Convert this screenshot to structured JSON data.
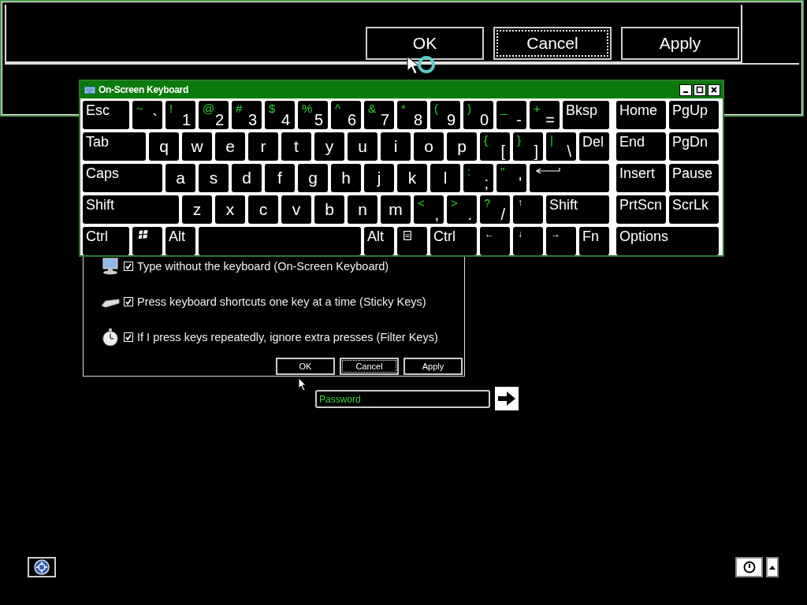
{
  "background_window": {
    "buttons": [
      {
        "label": "OK",
        "focused": false
      },
      {
        "label": "Cancel",
        "focused": true
      },
      {
        "label": "Apply",
        "focused": false
      }
    ]
  },
  "on_screen_keyboard": {
    "title": "On-Screen Keyboard",
    "rows": [
      {
        "keys": [
          {
            "kind": "label",
            "label": "Esc"
          },
          {
            "kind": "dual",
            "shift": "~",
            "base": "`"
          },
          {
            "kind": "dual",
            "shift": "!",
            "base": "1"
          },
          {
            "kind": "dual",
            "shift": "@",
            "base": "2"
          },
          {
            "kind": "dual",
            "shift": "#",
            "base": "3"
          },
          {
            "kind": "dual",
            "shift": "$",
            "base": "4"
          },
          {
            "kind": "dual",
            "shift": "%",
            "base": "5"
          },
          {
            "kind": "dual",
            "shift": "^",
            "base": "6"
          },
          {
            "kind": "dual",
            "shift": "&",
            "base": "7"
          },
          {
            "kind": "dual",
            "shift": "*",
            "base": "8"
          },
          {
            "kind": "dual",
            "shift": "(",
            "base": "9"
          },
          {
            "kind": "dual",
            "shift": ")",
            "base": "0"
          },
          {
            "kind": "dual",
            "shift": "_",
            "base": "-"
          },
          {
            "kind": "dual",
            "shift": "+",
            "base": "="
          },
          {
            "kind": "label",
            "label": "Bksp"
          }
        ]
      },
      {
        "keys": [
          {
            "kind": "label",
            "label": "Tab"
          },
          {
            "kind": "letter",
            "label": "q"
          },
          {
            "kind": "letter",
            "label": "w"
          },
          {
            "kind": "letter",
            "label": "e"
          },
          {
            "kind": "letter",
            "label": "r"
          },
          {
            "kind": "letter",
            "label": "t"
          },
          {
            "kind": "letter",
            "label": "y"
          },
          {
            "kind": "letter",
            "label": "u"
          },
          {
            "kind": "letter",
            "label": "i"
          },
          {
            "kind": "letter",
            "label": "o"
          },
          {
            "kind": "letter",
            "label": "p"
          },
          {
            "kind": "dual",
            "shift": "{",
            "base": "["
          },
          {
            "kind": "dual",
            "shift": "}",
            "base": "]"
          },
          {
            "kind": "dual",
            "shift": "|",
            "base": "\\"
          },
          {
            "kind": "label",
            "label": "Del"
          }
        ]
      },
      {
        "keys": [
          {
            "kind": "label",
            "label": "Caps"
          },
          {
            "kind": "letter",
            "label": "a"
          },
          {
            "kind": "letter",
            "label": "s"
          },
          {
            "kind": "letter",
            "label": "d"
          },
          {
            "kind": "letter",
            "label": "f"
          },
          {
            "kind": "letter",
            "label": "g"
          },
          {
            "kind": "letter",
            "label": "h"
          },
          {
            "kind": "letter",
            "label": "j"
          },
          {
            "kind": "letter",
            "label": "k"
          },
          {
            "kind": "letter",
            "label": "l"
          },
          {
            "kind": "dual",
            "shift": ":",
            "base": ";"
          },
          {
            "kind": "dual",
            "shift": "\"",
            "base": "'"
          },
          {
            "kind": "enter"
          }
        ]
      },
      {
        "keys": [
          {
            "kind": "label",
            "label": "Shift"
          },
          {
            "kind": "letter",
            "label": "z"
          },
          {
            "kind": "letter",
            "label": "x"
          },
          {
            "kind": "letter",
            "label": "c"
          },
          {
            "kind": "letter",
            "label": "v"
          },
          {
            "kind": "letter",
            "label": "b"
          },
          {
            "kind": "letter",
            "label": "n"
          },
          {
            "kind": "letter",
            "label": "m"
          },
          {
            "kind": "dual",
            "shift": "<",
            "base": ","
          },
          {
            "kind": "dual",
            "shift": ">",
            "base": "."
          },
          {
            "kind": "dual",
            "shift": "?",
            "base": "/"
          },
          {
            "kind": "arrow",
            "label": "↑"
          },
          {
            "kind": "label",
            "label": "Shift"
          }
        ]
      },
      {
        "keys": [
          {
            "kind": "label",
            "label": "Ctrl"
          },
          {
            "kind": "windows"
          },
          {
            "kind": "label",
            "label": "Alt"
          },
          {
            "kind": "space"
          },
          {
            "kind": "label",
            "label": "Alt"
          },
          {
            "kind": "menu"
          },
          {
            "kind": "label",
            "label": "Ctrl"
          },
          {
            "kind": "arrow",
            "label": "←"
          },
          {
            "kind": "arrow",
            "label": "↓"
          },
          {
            "kind": "arrow",
            "label": "→"
          },
          {
            "kind": "label",
            "label": "Fn"
          }
        ]
      }
    ],
    "nav_rows": [
      [
        "Home",
        "PgUp"
      ],
      [
        "End",
        "PgDn"
      ],
      [
        "Insert",
        "Pause"
      ],
      [
        "PrtScn",
        "ScrLk"
      ],
      [
        "Options"
      ]
    ]
  },
  "ease_dialog": {
    "options": [
      {
        "kind": "keyboard",
        "label": "Type without the keyboard (On-Screen Keyboard)",
        "checked": true
      },
      {
        "kind": "keys",
        "label": "Press keyboard shortcuts one key at a time (Sticky Keys)",
        "checked": true
      },
      {
        "kind": "stopwatch",
        "label": "If I press keys repeatedly, ignore extra presses (Filter Keys)",
        "checked": true
      }
    ],
    "buttons": [
      {
        "label": "OK",
        "focused": false
      },
      {
        "label": "Cancel",
        "focused": true
      },
      {
        "label": "Apply",
        "focused": false
      }
    ]
  },
  "login": {
    "password": {
      "placeholder": "Password"
    }
  }
}
